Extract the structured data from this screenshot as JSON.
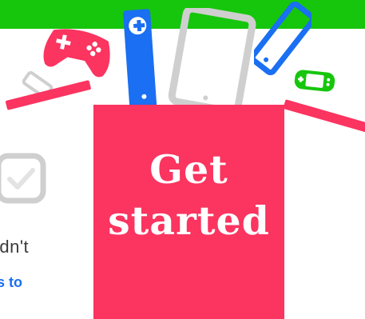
{
  "banner": {
    "color": "#16c60c"
  },
  "box": {
    "label_line1": "Get",
    "label_line2": "started",
    "color": "#fb3460"
  },
  "left_content": {
    "checkbox_icon": "checkmark-icon",
    "partial_text": "ldn't",
    "partial_link": "s to"
  },
  "devices": [
    "gamepad-icon",
    "phone-icon",
    "remote-icon",
    "tablet-icon",
    "smartphone-icon",
    "handheld-console-icon"
  ]
}
